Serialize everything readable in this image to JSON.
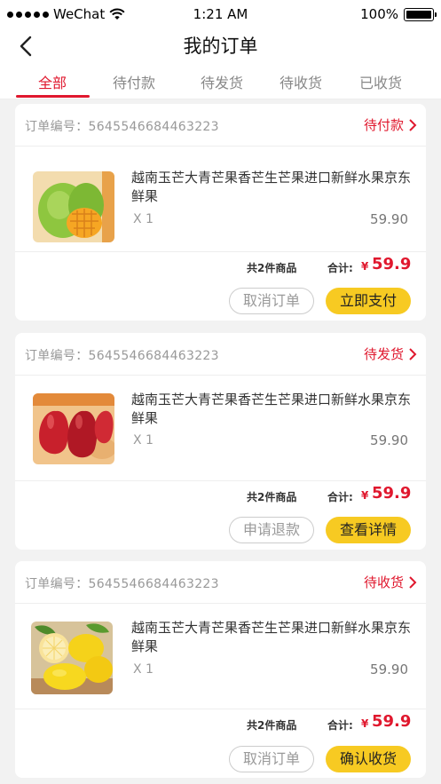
{
  "status_bar": {
    "carrier": "WeChat",
    "time": "1:21 AM",
    "battery": "100%"
  },
  "nav": {
    "title": "我的订单"
  },
  "tabs": [
    {
      "label": "全部",
      "active": true
    },
    {
      "label": "待付款"
    },
    {
      "label": "待发货"
    },
    {
      "label": "待收货"
    },
    {
      "label": "已收货"
    }
  ],
  "orders": [
    {
      "order_no": "订单编号：5645546684463223",
      "status": "待付款",
      "product": {
        "name": "越南玉芒大青芒果香芒生芒果进口新鲜水果京东鲜果",
        "qty": "X 1",
        "price": "59.90",
        "image": "mango"
      },
      "summary": "共2件商品",
      "total_label": "合计:",
      "currency": "¥",
      "total": "59.9",
      "buttons": {
        "secondary": "取消订单",
        "primary": "立即支付"
      }
    },
    {
      "order_no": "订单编号：5645546684463223",
      "status": "待发货",
      "product": {
        "name": "越南玉芒大青芒果香芒生芒果进口新鲜水果京东鲜果",
        "qty": "X 1",
        "price": "59.90",
        "image": "wax-apple"
      },
      "summary": "共2件商品",
      "total_label": "合计:",
      "currency": "¥",
      "total": "59.9",
      "buttons": {
        "secondary": "申请退款",
        "primary": "查看详情"
      }
    },
    {
      "order_no": "订单编号：5645546684463223",
      "status": "待收货",
      "product": {
        "name": "越南玉芒大青芒果香芒生芒果进口新鲜水果京东鲜果",
        "qty": "X 1",
        "price": "59.90",
        "image": "lemon"
      },
      "summary": "共2件商品",
      "total_label": "合计:",
      "currency": "¥",
      "total": "59.9",
      "buttons": {
        "secondary": "取消订单",
        "primary": "确认收货"
      }
    }
  ],
  "colors": {
    "accent": "#e0182e",
    "button": "#f7ca22",
    "background": "#f2f2f2"
  },
  "icons": {
    "back": "chevron-left-icon",
    "status": "chevron-right-icon",
    "wifi": "wifi-icon",
    "battery": "battery-icon"
  }
}
